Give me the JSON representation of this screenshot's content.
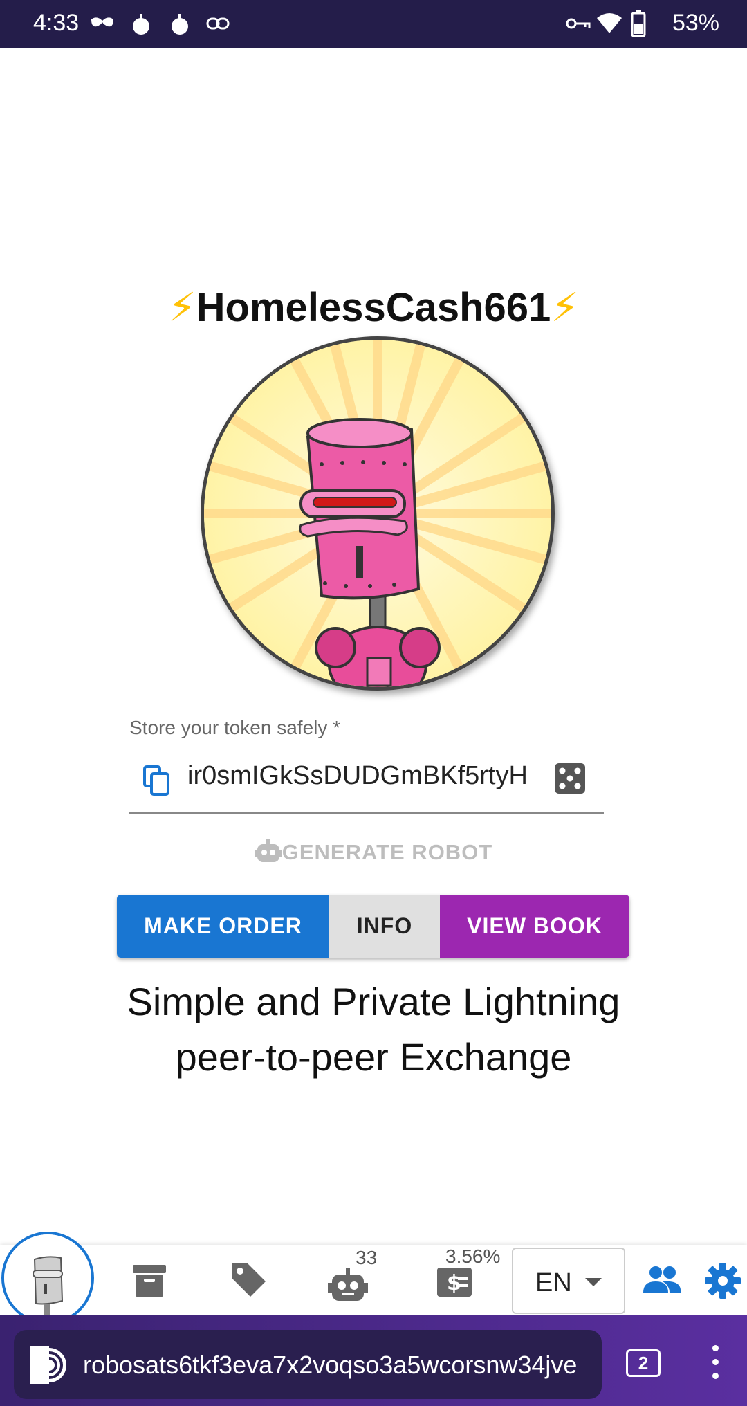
{
  "status_bar": {
    "time": "4:33",
    "battery": "53%",
    "icons": [
      "incognito-icon",
      "bomb-icon",
      "bomb-icon",
      "link-icon",
      "vpn-key-icon",
      "wifi-icon",
      "battery-icon"
    ]
  },
  "profile": {
    "username": "HomelessCash661",
    "bolt": "⚡"
  },
  "token": {
    "label": "Store your token safely *",
    "value": "ir0smIGkSsDUDGmBKf5rtyH"
  },
  "actions": {
    "generate_robot": "GENERATE ROBOT",
    "make_order": "MAKE ORDER",
    "info": "INFO",
    "view_book": "VIEW BOOK"
  },
  "tagline": {
    "line1": "Simple and Private Lightning",
    "line2": "peer-to-peer Exchange"
  },
  "bottom_nav": {
    "robots_count": "33",
    "fee_percent": "3.56%",
    "language": "EN"
  },
  "browser": {
    "url": "robosats6tkf3eva7x2voqso3a5wcorsnw34jve",
    "tab_count": "2"
  },
  "colors": {
    "status_bar": "#241d4a",
    "make_order": "#1976d2",
    "view_book": "#9c27b0",
    "info": "#e0e0e0",
    "accent": "#1976d2"
  }
}
